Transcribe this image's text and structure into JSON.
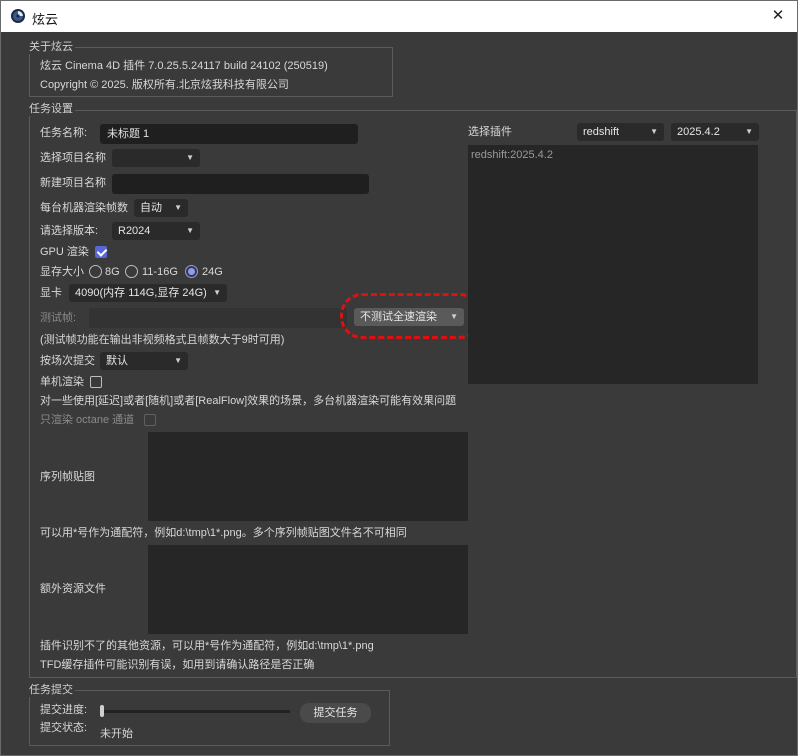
{
  "window": {
    "title": "炫云",
    "close_glyph": "✕"
  },
  "about": {
    "legend": "关于炫云",
    "version_line": "炫云 Cinema 4D 插件 7.0.25.5.24117 build 24102  (250519)",
    "copyright": "Copyright © 2025. 版权所有.北京炫我科技有限公司"
  },
  "task": {
    "legend": "任务设置",
    "task_name_label": "任务名称:",
    "task_name_value": "未标题 1",
    "select_project_label": "选择项目名称",
    "select_project_value": "",
    "new_project_label": "新建项目名称",
    "new_project_value": "",
    "frames_per_machine_label": "每台机器渲染帧数",
    "frames_per_machine_value": "自动",
    "version_label": "请选择版本:",
    "version_value": "R2024",
    "gpu_label": "GPU 渲染",
    "gpu_checked": true,
    "vram_label": "显存大小",
    "vram_options": [
      "8G",
      "11-16G",
      "24G"
    ],
    "vram_selected": "24G",
    "gpu_card_label": "显卡",
    "gpu_card_value": "4090(内存 114G,显存 24G)",
    "test_frame_label": "测试帧:",
    "test_frame_value": "",
    "test_mode_value": "不测试全速渲染",
    "test_note": "(测试帧功能在输出非视频格式且帧数大于9时可用)",
    "submit_by_label": "按场次提交",
    "submit_by_value": "默认",
    "single_render_label": "单机渲染",
    "single_render_checked": false,
    "warning_note": "对一些使用[延迟]或者[随机]或者[RealFlow]效果的场景，多台机器渲染可能有效果问题",
    "octane_only_label": "只渲染 octane 通道",
    "octane_only_checked": false,
    "sequence_label": "序列帧贴图",
    "sequence_value": "",
    "sequence_note": "可以用*号作为通配符，例如d:\\tmp\\1*.png。多个序列帧贴图文件名不可相同",
    "extra_label": "额外资源文件",
    "extra_value": "",
    "extra_note1": "插件识别不了的其他资源，可以用*号作为通配符，例如d:\\tmp\\1*.png",
    "extra_note2": "TFD缓存插件可能识别有误，如用到请确认路径是否正确",
    "plugin_label": "选择插件",
    "plugin_value": "redshift",
    "plugin_version_value": "2025.4.2",
    "plugin_list": [
      "redshift:2025.4.2"
    ]
  },
  "submit": {
    "legend": "任务提交",
    "progress_label": "提交进度:",
    "progress_value": 0,
    "status_label": "提交状态:",
    "status_value": "未开始",
    "submit_button": "提交任务"
  },
  "colors": {
    "accent": "#5866d8",
    "highlight": "#e01010"
  }
}
